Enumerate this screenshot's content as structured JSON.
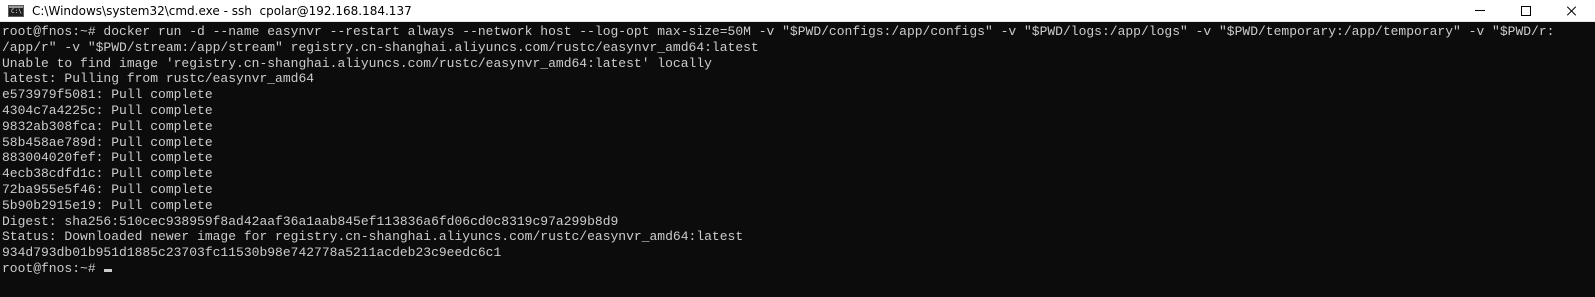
{
  "window": {
    "title": "C:\\Windows\\system32\\cmd.exe - ssh  cpolar@192.168.184.137",
    "icon": "cmd-icon",
    "controls": {
      "minimize": "minimize-icon",
      "maximize": "maximize-icon",
      "close": "close-icon"
    }
  },
  "terminal": {
    "background": "#0c0c0c",
    "foreground": "#cccccc",
    "lines": [
      "root@fnos:~# docker run -d --name easynvr --restart always --network host --log-opt max-size=50M -v \"$PWD/configs:/app/configs\" -v \"$PWD/logs:/app/logs\" -v \"$PWD/temporary:/app/temporary\" -v \"$PWD/r:",
      "/app/r\" -v \"$PWD/stream:/app/stream\" registry.cn-shanghai.aliyuncs.com/rustc/easynvr_amd64:latest",
      "Unable to find image 'registry.cn-shanghai.aliyuncs.com/rustc/easynvr_amd64:latest' locally",
      "latest: Pulling from rustc/easynvr_amd64",
      "e573979f5081: Pull complete",
      "4304c7a4225c: Pull complete",
      "9832ab308fca: Pull complete",
      "58b458ae789d: Pull complete",
      "883004020fef: Pull complete",
      "4ecb38cdfd1c: Pull complete",
      "72ba955e5f46: Pull complete",
      "5b90b2915e19: Pull complete",
      "Digest: sha256:510cec938959f8ad42aaf36a1aab845ef113836a6fd06cd0c8319c97a299b8d9",
      "Status: Downloaded newer image for registry.cn-shanghai.aliyuncs.com/rustc/easynvr_amd64:latest",
      "934d793db01b951d1885c23703fc11530b98e742778a5211acdeb23c9eedc6c1"
    ],
    "prompt": "root@fnos:~# "
  }
}
